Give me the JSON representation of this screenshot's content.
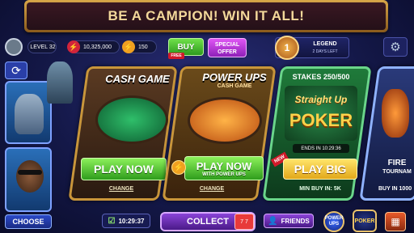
{
  "banner": {
    "text": "BE A CAMPION! WIN IT ALL!"
  },
  "topbar": {
    "level": "LEVEL 32",
    "chips": "10,325,000",
    "gems": "150",
    "buy": "BUY",
    "free": "FREE",
    "special_offer": "SPECIAL OFFER",
    "legend_title": "LEGEND",
    "legend_sub": "2 DAYS LEFT",
    "legend_rank": "1"
  },
  "left": {
    "choose": "CHOOSE"
  },
  "cards": {
    "cash_game": {
      "title": "CASH GAME",
      "play": "PLAY NOW",
      "change": "CHANGE"
    },
    "power_ups": {
      "title": "POWER UPS",
      "subtitle": "CASH GAME",
      "play": "PLAY NOW",
      "play_sub": "WITH POWER UPS",
      "change": "CHANGE"
    },
    "straight_up": {
      "stakes": "STAKES 250/500",
      "logo_top": "Straight Up",
      "logo_main": "POKER",
      "ends": "ENDS IN 10:29:36",
      "new": "NEW",
      "play": "PLAY BIG",
      "min_buy": "MIN BUY IN: 5K"
    },
    "fire": {
      "title": "FIRE",
      "subtitle": "TOURNAM",
      "buy_in": "BUY IN 1000"
    }
  },
  "bottom": {
    "timer": "10:29:37",
    "collect": "COLLECT",
    "friends": "FRIENDS",
    "power_ups_icon": "POWER UPS",
    "poker_icon": "POKER"
  },
  "colors": {
    "accent_gold": "#c9963a",
    "play_green": "#2f9c1c",
    "collect_purple": "#8a43d8"
  }
}
